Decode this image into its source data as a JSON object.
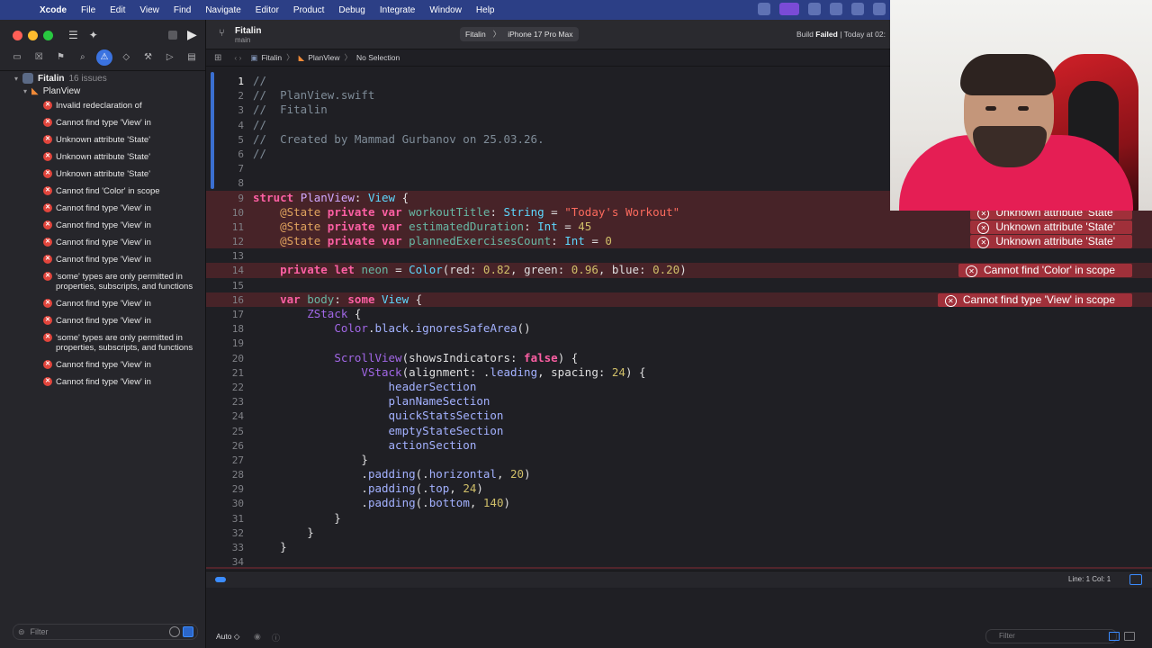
{
  "menubar": {
    "app_name": "Xcode",
    "items": [
      "File",
      "Edit",
      "View",
      "Find",
      "Navigate",
      "Editor",
      "Product",
      "Debug",
      "Integrate",
      "Window",
      "Help"
    ]
  },
  "navigator": {
    "project": {
      "name": "Fitalin",
      "issue_count": "16 issues"
    },
    "file": {
      "name": "PlanView"
    },
    "issues": [
      "Invalid redeclaration of",
      "Cannot find type 'View' in",
      "Unknown attribute 'State'",
      "Unknown attribute 'State'",
      "Unknown attribute 'State'",
      "Cannot find 'Color' in scope",
      "Cannot find type 'View' in",
      "Cannot find type 'View' in",
      "Cannot find type 'View' in",
      "Cannot find type 'View' in",
      "'some' types are only permitted in properties, subscripts, and functions",
      "Cannot find type 'View' in",
      "Cannot find type 'View' in",
      "'some' types are only permitted in properties, subscripts, and functions",
      "Cannot find type 'View' in",
      "Cannot find type 'View' in"
    ],
    "filter_placeholder": "Filter"
  },
  "toolbar": {
    "project_title": "Fitalin",
    "branch": "main",
    "scheme": "Fitalin",
    "device": "iPhone 17 Pro Max",
    "status_prefix": "Build",
    "status_state": "Failed",
    "status_suffix": "| Today at 02:"
  },
  "jumpbar": {
    "crumbs": [
      "Fitalin",
      "PlanView",
      "No Selection"
    ]
  },
  "editor": {
    "lines": [
      {
        "n": "1"
      },
      {
        "n": "2"
      },
      {
        "n": "3"
      },
      {
        "n": "4"
      },
      {
        "n": "5"
      },
      {
        "n": "6"
      },
      {
        "n": "7"
      },
      {
        "n": "8"
      },
      {
        "n": "9"
      },
      {
        "n": "10"
      },
      {
        "n": "11"
      },
      {
        "n": "12"
      },
      {
        "n": "13"
      },
      {
        "n": "14"
      },
      {
        "n": "15"
      },
      {
        "n": "16"
      },
      {
        "n": "17"
      },
      {
        "n": "18"
      },
      {
        "n": "19"
      },
      {
        "n": "20"
      },
      {
        "n": "21"
      },
      {
        "n": "22"
      },
      {
        "n": "23"
      },
      {
        "n": "24"
      },
      {
        "n": "25"
      },
      {
        "n": "26"
      },
      {
        "n": "27"
      },
      {
        "n": "28"
      },
      {
        "n": "29"
      },
      {
        "n": "30"
      },
      {
        "n": "31"
      },
      {
        "n": "32"
      },
      {
        "n": "33"
      },
      {
        "n": "34"
      }
    ],
    "errors": {
      "l10": "Unknown attribute 'State'",
      "l11": "Unknown attribute 'State'",
      "l12": "Unknown attribute 'State'",
      "l14": "Cannot find 'Color' in scope",
      "l16": "Cannot find type 'View' in scope"
    }
  },
  "debug": {
    "position": "Line: 1  Col: 1",
    "auto_label": "Auto ◇",
    "filter_placeholder": "Filter"
  },
  "colors": {
    "menubar": "#2c3f86",
    "editor_bg": "#1f1f24",
    "error_badge": "#a0303a",
    "accent": "#3b8cff",
    "keyword": "#fc5fa3",
    "string": "#fc6a5d",
    "number": "#d0bf69"
  }
}
